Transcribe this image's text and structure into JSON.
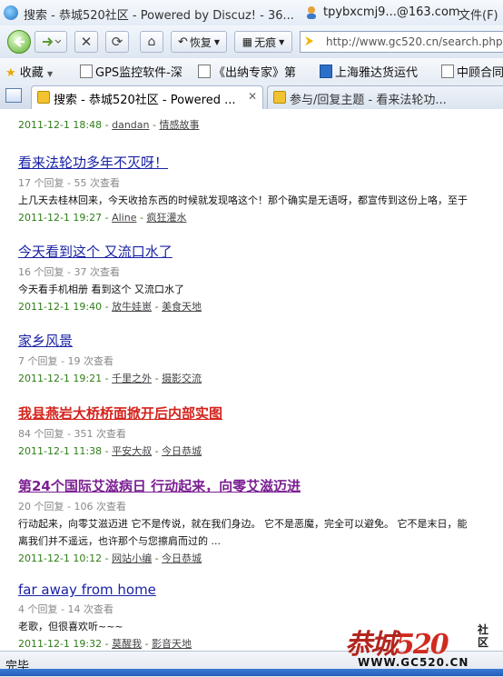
{
  "titlebar": {
    "title": "搜索 - 恭城520社区 - Powered by Discuz! - 36...",
    "account": "tpybxcmj9...@163.com",
    "file_menu": "文件(F)"
  },
  "navbar": {
    "restore_label": "恢复",
    "incognito_label": "无痕",
    "url": "http://www.gc520.cn/search.php?"
  },
  "favorites": {
    "label": "收藏",
    "items": [
      "GPS监控软件-深",
      "《出纳专家》第",
      "上海雅达货运代",
      "中顾合同"
    ]
  },
  "tabs": [
    {
      "label": "搜索 - 恭城520社区 - Powered ...",
      "active": true
    },
    {
      "label": "参与/回复主题 - 看来法轮功...",
      "active": false
    }
  ],
  "results": [
    {
      "title": "",
      "stats": "",
      "excerpt": "",
      "date": "2011-12-1 18:48",
      "author": "dandan",
      "forum": "情感故事",
      "style": "normal"
    },
    {
      "title": "看来法轮功多年不灭呀！",
      "stats": "17 个回复 - 55 次查看",
      "excerpt": "上几天去桂林回来，今天收拾东西的时候就发现咯这个！那个确实是无语呀，都宣传到这份上咯，至于",
      "date": "2011-12-1 19:27",
      "author": "Aline",
      "forum": "疯狂灌水",
      "style": "normal"
    },
    {
      "title": "今天看到这个 又流口水了",
      "stats": "16 个回复 - 37 次查看",
      "excerpt": "今天看手机相册 看到这个 又流口水了",
      "date": "2011-12-1 19:40",
      "author": "放牛娃崽",
      "forum": "美食天地",
      "style": "normal"
    },
    {
      "title": "家乡风景",
      "stats": "7 个回复 - 19 次查看",
      "excerpt": "",
      "date": "2011-12-1 19:21",
      "author": "千里之外",
      "forum": "摄影交流",
      "style": "normal"
    },
    {
      "title": "我县燕岩大桥桥面掀开后内部实图",
      "stats": "84 个回复 - 351 次查看",
      "excerpt": "",
      "date": "2011-12-1 11:38",
      "author": "平安大叔",
      "forum": "今日恭城",
      "style": "red"
    },
    {
      "title": "第24个国际艾滋病日 行动起来，向零艾滋迈进",
      "stats": "20 个回复 - 106 次查看",
      "excerpt": "行动起来，向零艾滋迈进 它不是传说，就在我们身边。 它不是恶魔，完全可以避免。 它不是末日，能",
      "excerpt2": "离我们并不遥远，也许那个与您擦肩而过的 ...",
      "date": "2011-12-1 10:12",
      "author": "网站小编",
      "forum": "今日恭城",
      "style": "purple"
    },
    {
      "title": "far away from home",
      "stats": "4 个回复 - 14 次查看",
      "excerpt": "老歌，但很喜欢听~~~",
      "date": "2011-12-1 19:32",
      "author": "莫醒我",
      "forum": "影音天地",
      "style": "normal"
    }
  ],
  "status": "完毕",
  "watermark": {
    "logo_text": "恭城",
    "logo_num": "520",
    "side_text": "社区",
    "url": "WWW.GC520.CN"
  }
}
